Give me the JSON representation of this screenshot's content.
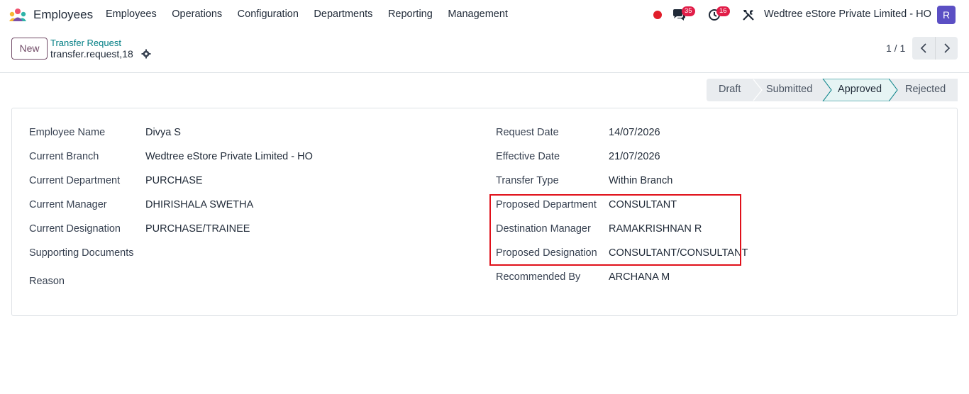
{
  "app": {
    "name": "Employees"
  },
  "menu": [
    "Employees",
    "Operations",
    "Configuration",
    "Departments",
    "Reporting",
    "Management"
  ],
  "systray": {
    "chat_count": "35",
    "activity_count": "16",
    "company": "Wedtree eStore Private Limited - HO",
    "avatar_letter": "R"
  },
  "control": {
    "new_label": "New",
    "breadcrumb_parent": "Transfer Request",
    "record_name": "transfer.request,18",
    "pager": "1 / 1"
  },
  "status": {
    "stages": [
      "Draft",
      "Submitted",
      "Approved",
      "Rejected"
    ],
    "current": "Approved"
  },
  "form": {
    "left": [
      {
        "label": "Employee Name",
        "value": "Divya S"
      },
      {
        "label": "Current Branch",
        "value": "Wedtree eStore Private Limited - HO"
      },
      {
        "label": "Current Department",
        "value": "PURCHASE"
      },
      {
        "label": "Current Manager",
        "value": "DHIRISHALA SWETHA"
      },
      {
        "label": "Current Designation",
        "value": "PURCHASE/TRAINEE"
      },
      {
        "label": "Supporting Documents",
        "value": ""
      },
      {
        "label": "Reason",
        "value": ""
      }
    ],
    "right": [
      {
        "label": "Request Date",
        "value": "14/07/2026"
      },
      {
        "label": "Effective Date",
        "value": "21/07/2026"
      },
      {
        "label": "Transfer Type",
        "value": "Within Branch"
      },
      {
        "label": "Proposed Department",
        "value": "CONSULTANT"
      },
      {
        "label": "Destination Manager",
        "value": "RAMAKRISHNAN R"
      },
      {
        "label": "Proposed Designation",
        "value": "CONSULTANT/CONSULTANT"
      },
      {
        "label": "Recommended By",
        "value": "ARCHANA M"
      }
    ]
  },
  "colors": {
    "brand": "#714b67",
    "link": "#017e84",
    "highlight": "#e0101a",
    "approved_bg": "#e6f4f4",
    "approved_border": "#017e84"
  },
  "icons": [
    "app-logo-icon",
    "chat-icon",
    "clock-icon",
    "tools-icon",
    "gear-icon",
    "chevron-left-icon",
    "chevron-right-icon"
  ]
}
